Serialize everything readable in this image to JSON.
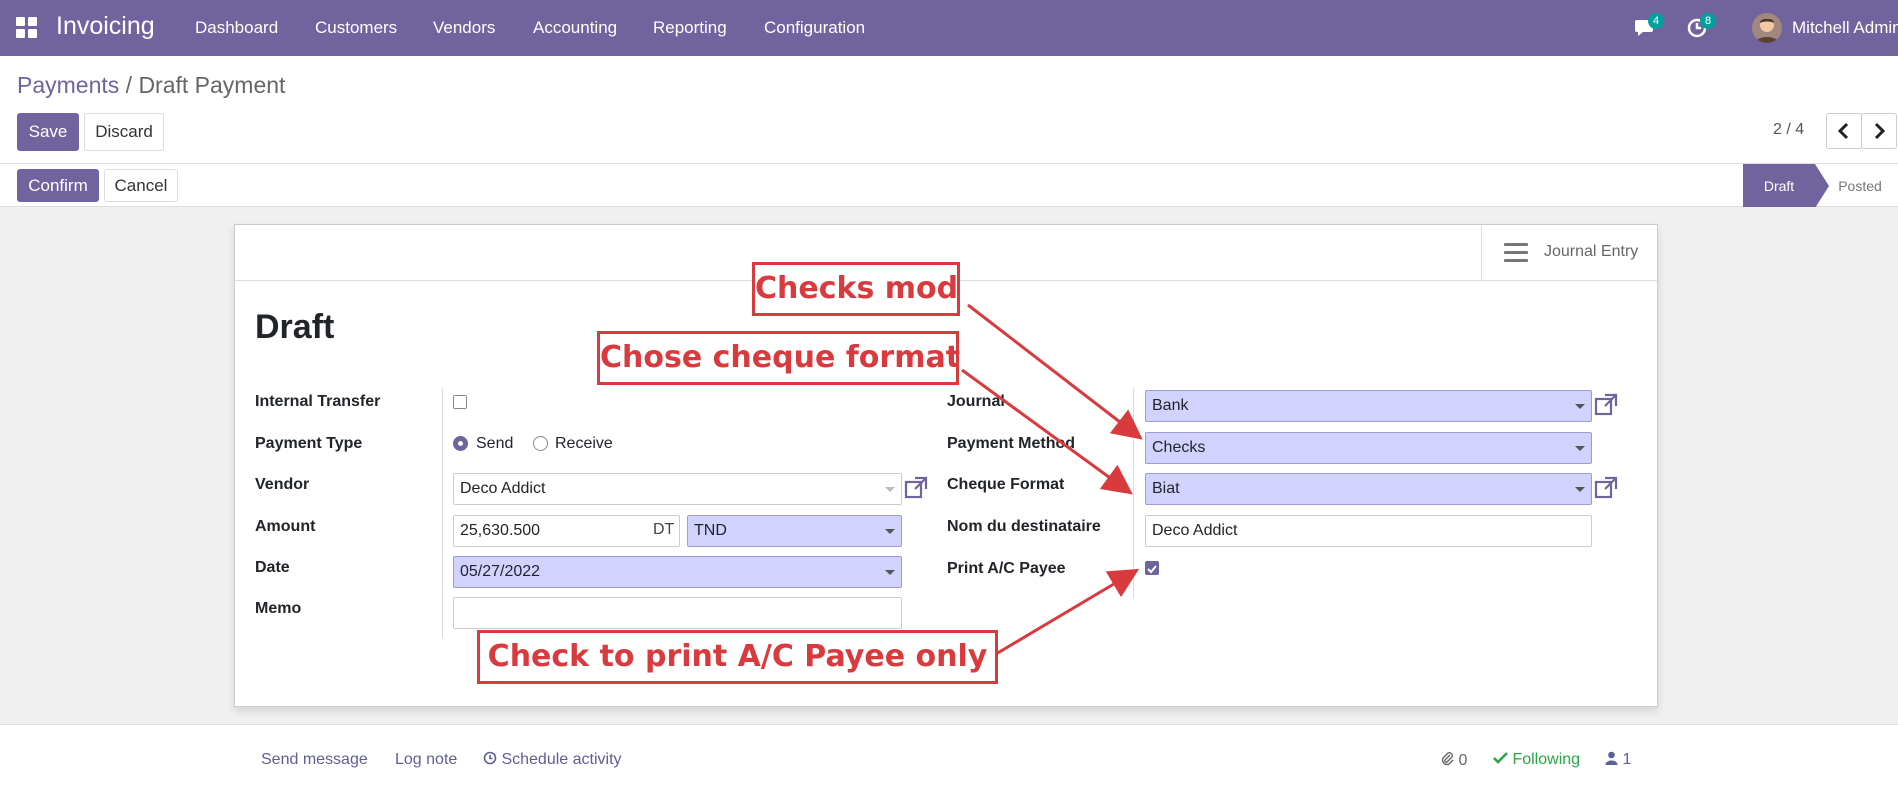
{
  "navbar": {
    "brand": "Invoicing",
    "menu": [
      "Dashboard",
      "Customers",
      "Vendors",
      "Accounting",
      "Reporting",
      "Configuration"
    ],
    "messages_count": "4",
    "activities_count": "8",
    "user_name": "Mitchell Admin",
    "accent_color": "#71639e"
  },
  "breadcrumb": {
    "parent": "Payments",
    "separator": "/",
    "current": "Draft Payment"
  },
  "toolbar": {
    "save_label": "Save",
    "discard_label": "Discard"
  },
  "pager": {
    "value": "2 / 4"
  },
  "statusbar": {
    "confirm_label": "Confirm",
    "cancel_label": "Cancel",
    "stages": [
      "Draft",
      "Posted"
    ],
    "active_stage": "Draft"
  },
  "sheet": {
    "journal_entry_label": "Journal Entry",
    "title": "Draft",
    "left_fields": {
      "internal_transfer_label": "Internal Transfer",
      "payment_type_label": "Payment Type",
      "payment_type_options": [
        "Send",
        "Receive"
      ],
      "payment_type_selected": "Send",
      "vendor_label": "Vendor",
      "vendor_value": "Deco Addict",
      "amount_label": "Amount",
      "amount_value": "25,630.500",
      "currency_symbol": "DT",
      "currency_value": "TND",
      "date_label": "Date",
      "date_value": "05/27/2022",
      "memo_label": "Memo",
      "memo_value": ""
    },
    "right_fields": {
      "journal_label": "Journal",
      "journal_value": "Bank",
      "payment_method_label": "Payment Method",
      "payment_method_value": "Checks",
      "cheque_format_label": "Cheque Format",
      "cheque_format_value": "Biat",
      "nom_destinataire_label": "Nom du destinataire",
      "nom_destinataire_value": "Deco Addict",
      "print_ac_payee_label": "Print A/C Payee",
      "print_ac_payee_checked": true
    }
  },
  "annotations": {
    "checks_mod": "Checks mod",
    "chose_cheque_format": "Chose cheque format",
    "check_to_print": "Check to print A/C Payee only",
    "color": "#d93a3e"
  },
  "chatter": {
    "send_message": "Send message",
    "log_note": "Log note",
    "schedule_activity": "Schedule activity",
    "attachments_count": "0",
    "following_label": "Following",
    "followers_count": "1"
  }
}
